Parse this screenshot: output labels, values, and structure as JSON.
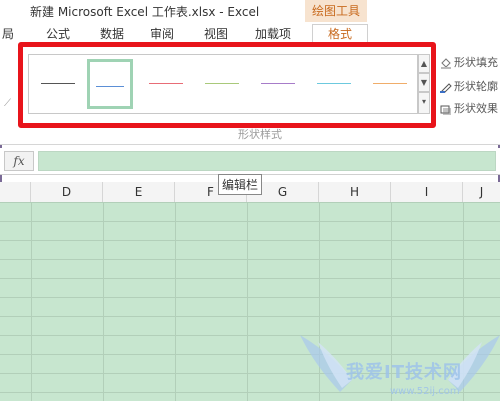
{
  "window": {
    "title": "新建 Microsoft Excel 工作表.xlsx - Excel",
    "context_tab_group": "绘图工具"
  },
  "ribbon_tabs": [
    {
      "label": "局",
      "active": false
    },
    {
      "label": "公式",
      "active": false
    },
    {
      "label": "数据",
      "active": false
    },
    {
      "label": "审阅",
      "active": false
    },
    {
      "label": "视图",
      "active": false
    },
    {
      "label": "加载项",
      "active": false
    },
    {
      "label": "格式",
      "active": true
    }
  ],
  "shape_styles": {
    "group_label": "形状样式",
    "swatches": [
      {
        "color": "#555555",
        "selected": false
      },
      {
        "color": "#5b8fd6",
        "selected": true
      },
      {
        "color": "#e86c76",
        "selected": false
      },
      {
        "color": "#a9c97a",
        "selected": false
      },
      {
        "color": "#a77cc9",
        "selected": false
      },
      {
        "color": "#6cc9de",
        "selected": false
      },
      {
        "color": "#f0ad6a",
        "selected": false
      }
    ],
    "side_commands": [
      {
        "label": "形状填充",
        "icon": "paint-bucket-icon"
      },
      {
        "label": "形状轮廓",
        "icon": "pencil-outline-icon"
      },
      {
        "label": "形状效果",
        "icon": "shape-effects-icon"
      }
    ]
  },
  "formula_bar": {
    "fx_label": "fx",
    "value": ""
  },
  "tooltip": "编辑栏",
  "columns": [
    "D",
    "E",
    "F",
    "G",
    "H",
    "I",
    "J"
  ],
  "watermark": {
    "text": "我爱IT技术网",
    "sub": "www.52ij.com"
  },
  "colors": {
    "highlight": "#e8141b",
    "accent": "#c86a1e",
    "grid_fill": "#c7e6cf"
  }
}
